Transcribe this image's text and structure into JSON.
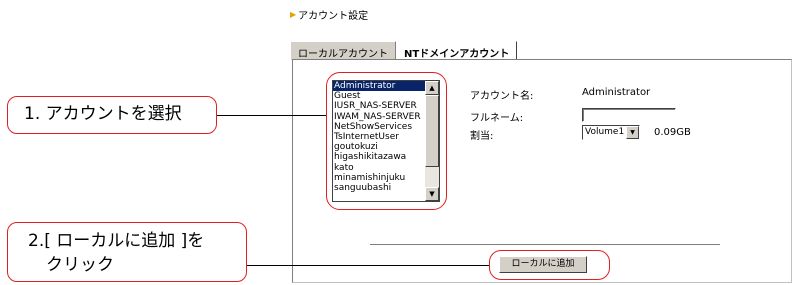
{
  "section": {
    "icon": "triangle-right-icon",
    "title": "アカウント設定"
  },
  "tabs": [
    {
      "label": "ローカルアカウント",
      "active": false
    },
    {
      "label": "NTドメインアカウント",
      "active": true
    }
  ],
  "accounts": {
    "items": [
      "Administrator",
      "Guest",
      "IUSR_NAS-SERVER",
      "IWAM_NAS-SERVER",
      "NetShowServices",
      "TsInternetUser",
      "goutokuzi",
      "higashikitazawa",
      "kato",
      "minamishinjuku",
      "sanguubashi"
    ],
    "selected_index": 0
  },
  "fields": {
    "account_name_label": "アカウント名:",
    "account_name_value": "Administrator",
    "fullname_label": "フルネーム:",
    "fullname_value": "",
    "quota_label": "割当:",
    "quota_volume": "Volume1",
    "quota_size": "0.09GB"
  },
  "add_local_button": "ローカルに追加",
  "callouts": {
    "step1": "1. アカウントを選択",
    "step2_line1": "2.[ ローカルに追加 ]を",
    "step2_line2": "クリック"
  },
  "colors": {
    "highlight": "#e02020",
    "selection": "#0a246a",
    "accent": "#e8a000"
  }
}
